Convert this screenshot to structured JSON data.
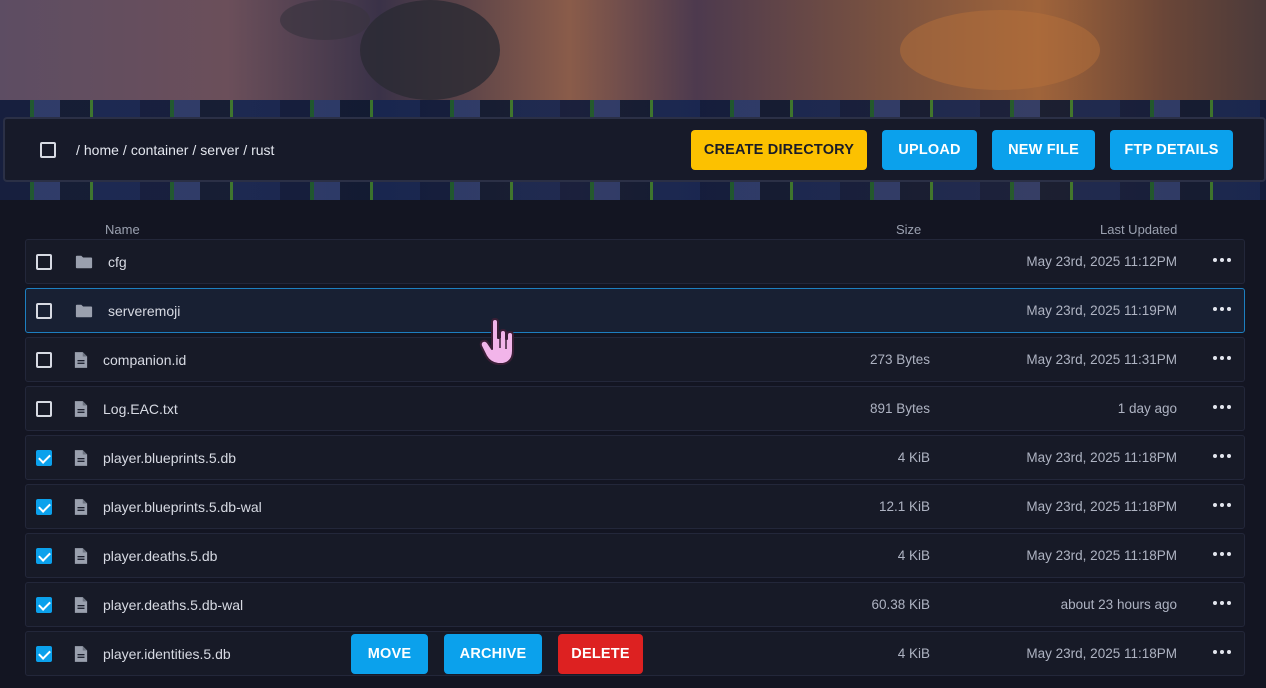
{
  "breadcrumb": {
    "parts": [
      "home",
      "container",
      "server",
      "rust"
    ]
  },
  "toolbar": {
    "create_directory": "CREATE DIRECTORY",
    "upload": "UPLOAD",
    "new_file": "NEW FILE",
    "ftp_details": "FTP DETAILS"
  },
  "columns": {
    "name": "Name",
    "size": "Size",
    "last_updated": "Last Updated"
  },
  "files": [
    {
      "name": "cfg",
      "type": "folder",
      "size": "",
      "updated": "May 23rd, 2025 11:12PM",
      "checked": false
    },
    {
      "name": "serveremoji",
      "type": "folder",
      "size": "",
      "updated": "May 23rd, 2025 11:19PM",
      "checked": false
    },
    {
      "name": "companion.id",
      "type": "file",
      "size": "273 Bytes",
      "updated": "May 23rd, 2025 11:31PM",
      "checked": false
    },
    {
      "name": "Log.EAC.txt",
      "type": "file",
      "size": "891 Bytes",
      "updated": "1 day ago",
      "checked": false
    },
    {
      "name": "player.blueprints.5.db",
      "type": "file",
      "size": "4 KiB",
      "updated": "May 23rd, 2025 11:18PM",
      "checked": true
    },
    {
      "name": "player.blueprints.5.db-wal",
      "type": "file",
      "size": "12.1 KiB",
      "updated": "May 23rd, 2025 11:18PM",
      "checked": true
    },
    {
      "name": "player.deaths.5.db",
      "type": "file",
      "size": "4 KiB",
      "updated": "May 23rd, 2025 11:18PM",
      "checked": true
    },
    {
      "name": "player.deaths.5.db-wal",
      "type": "file",
      "size": "60.38 KiB",
      "updated": "about 23 hours ago",
      "checked": true
    },
    {
      "name": "player.identities.5.db",
      "type": "file",
      "size": "4 KiB",
      "updated": "May 23rd, 2025 11:18PM",
      "checked": true
    }
  ],
  "selection_actions": {
    "move": "MOVE",
    "archive": "ARCHIVE",
    "delete": "DELETE"
  },
  "colors": {
    "accent_blue": "#0ba1ec",
    "accent_yellow": "#fcc100",
    "danger_red": "#dd2121",
    "background": "#131522"
  }
}
